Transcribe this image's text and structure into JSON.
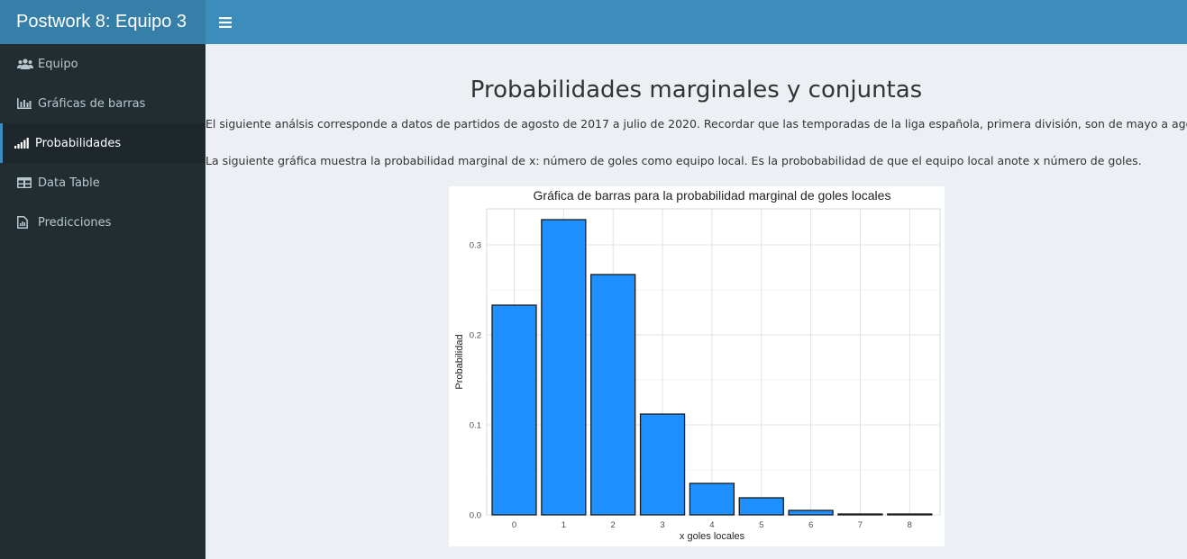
{
  "header": {
    "title": "Postwork 8: Equipo 3"
  },
  "sidebar": {
    "items": [
      {
        "label": "Equipo",
        "icon": "users-icon",
        "active": false
      },
      {
        "label": "Gráficas de barras",
        "icon": "bar-chart-icon",
        "active": false
      },
      {
        "label": "Probabilidades",
        "icon": "signal-icon",
        "active": true
      },
      {
        "label": "Data Table",
        "icon": "table-icon",
        "active": false
      },
      {
        "label": "Predicciones",
        "icon": "file-chart-icon",
        "active": false
      }
    ]
  },
  "main": {
    "title": "Probabilidades marginales y conjuntas",
    "paragraph1": "El siguiente análsis corresponde a datos de partidos de agosto de 2017 a julio de 2020. Recordar que las temporadas de la liga española, primera división, son de mayo a agosto.",
    "paragraph2": "La siguiente gráfica muestra la probabilidad marginal de x: número de goles como equipo local. Es la probobabilidad de que el equipo local anote x número de goles."
  },
  "colors": {
    "header": "#3c8dbc",
    "logo": "#367fa9",
    "sidebar": "#222d32",
    "bar_fill": "#1e90ff",
    "bar_outline": "#1a1a1a"
  },
  "chart_data": {
    "type": "bar",
    "title": "Gráfica de barras para la probabilidad marginal de goles locales",
    "xlabel": "x goles locales",
    "ylabel": "Probabilidad",
    "categories": [
      "0",
      "1",
      "2",
      "3",
      "4",
      "5",
      "6",
      "7",
      "8"
    ],
    "values": [
      0.233,
      0.328,
      0.267,
      0.112,
      0.035,
      0.019,
      0.005,
      0.001,
      0.001
    ],
    "yticks": [
      "0.0",
      "0.1",
      "0.2",
      "0.3"
    ],
    "ylim": [
      0,
      0.34
    ],
    "grid": true
  }
}
